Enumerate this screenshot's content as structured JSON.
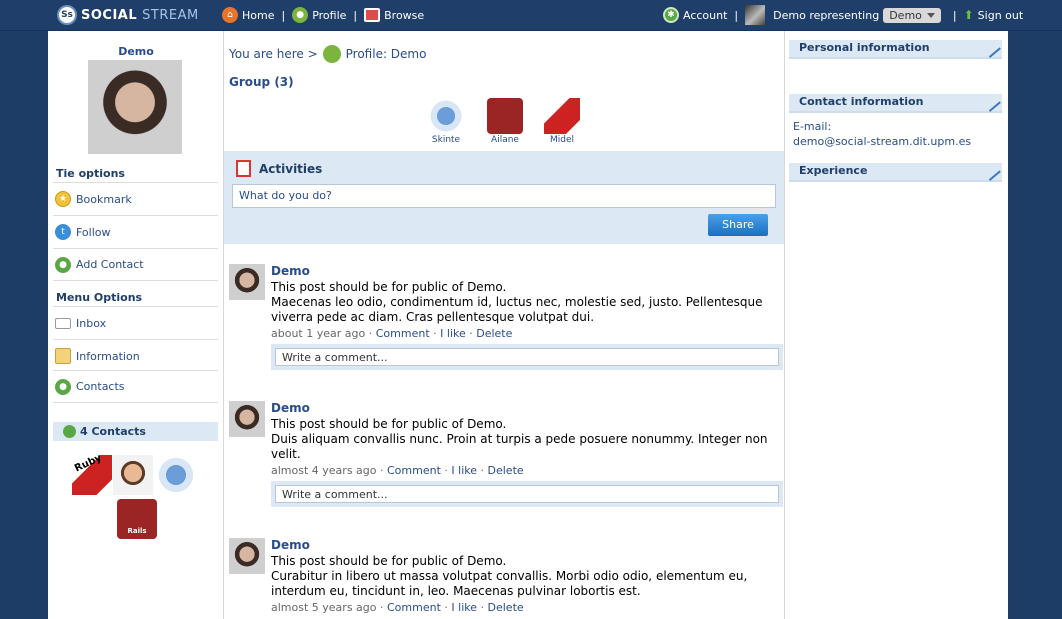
{
  "topbar": {
    "logo_text": "SOCIAL",
    "logo_text2": "STREAM",
    "logo_badge": "Ss",
    "home": "Home",
    "profile": "Profile",
    "browse": "Browse",
    "account": "Account",
    "representing": "Demo representing",
    "representing_select": "Demo",
    "sign_out": "Sign out"
  },
  "left": {
    "profile_name": "Demo",
    "tie_options_title": "Tie options",
    "tie_options": [
      "Bookmark",
      "Follow",
      "Add Contact"
    ],
    "menu_options_title": "Menu Options",
    "menu_options": [
      "Inbox",
      "Information",
      "Contacts"
    ],
    "contacts_title": "4 Contacts",
    "contacts": [
      "Ruby",
      "Person",
      "Skinte",
      "Rails"
    ]
  },
  "center": {
    "breadcrumb_prefix": "You are here >",
    "breadcrumb_current": "Profile: Demo",
    "group_title": "Group (3)",
    "groups": [
      {
        "name": "Skinte",
        "icon": "bird-icon"
      },
      {
        "name": "Ailane",
        "icon": "rails-icon"
      },
      {
        "name": "Midel",
        "icon": "ruby-icon"
      }
    ],
    "activities_title": "Activities",
    "activity_placeholder": "What do you do?",
    "share_label": "Share",
    "posts": [
      {
        "author": "Demo",
        "line1": "This post should be for public of Demo.",
        "line2": "Maecenas leo odio, condimentum id, luctus nec, molestie sed, justo. Pellentesque viverra pede ac diam. Cras pellentesque volutpat dui.",
        "time": "about 1 year ago",
        "comment": "Comment",
        "like": "I like",
        "delete": "Delete",
        "comment_placeholder": "Write a comment..."
      },
      {
        "author": "Demo",
        "line1": "This post should be for public of Demo.",
        "line2": "Duis aliquam convallis nunc. Proin at turpis a pede posuere nonummy. Integer non velit.",
        "time": "almost 4 years ago",
        "comment": "Comment",
        "like": "I like",
        "delete": "Delete",
        "comment_placeholder": "Write a comment..."
      },
      {
        "author": "Demo",
        "line1": "This post should be for public of Demo.",
        "line2": "Curabitur in libero ut massa volutpat convallis. Morbi odio odio, elementum eu, interdum eu, tincidunt in, leo. Maecenas pulvinar lobortis est.",
        "time": "almost 5 years ago",
        "comment": "Comment",
        "like": "I like",
        "delete": "Delete"
      }
    ]
  },
  "right": {
    "personal_title": "Personal information",
    "contact_title": "Contact information",
    "email_label": "E-mail:",
    "email_value": "demo@social-stream.dit.upm.es",
    "experience_title": "Experience"
  }
}
